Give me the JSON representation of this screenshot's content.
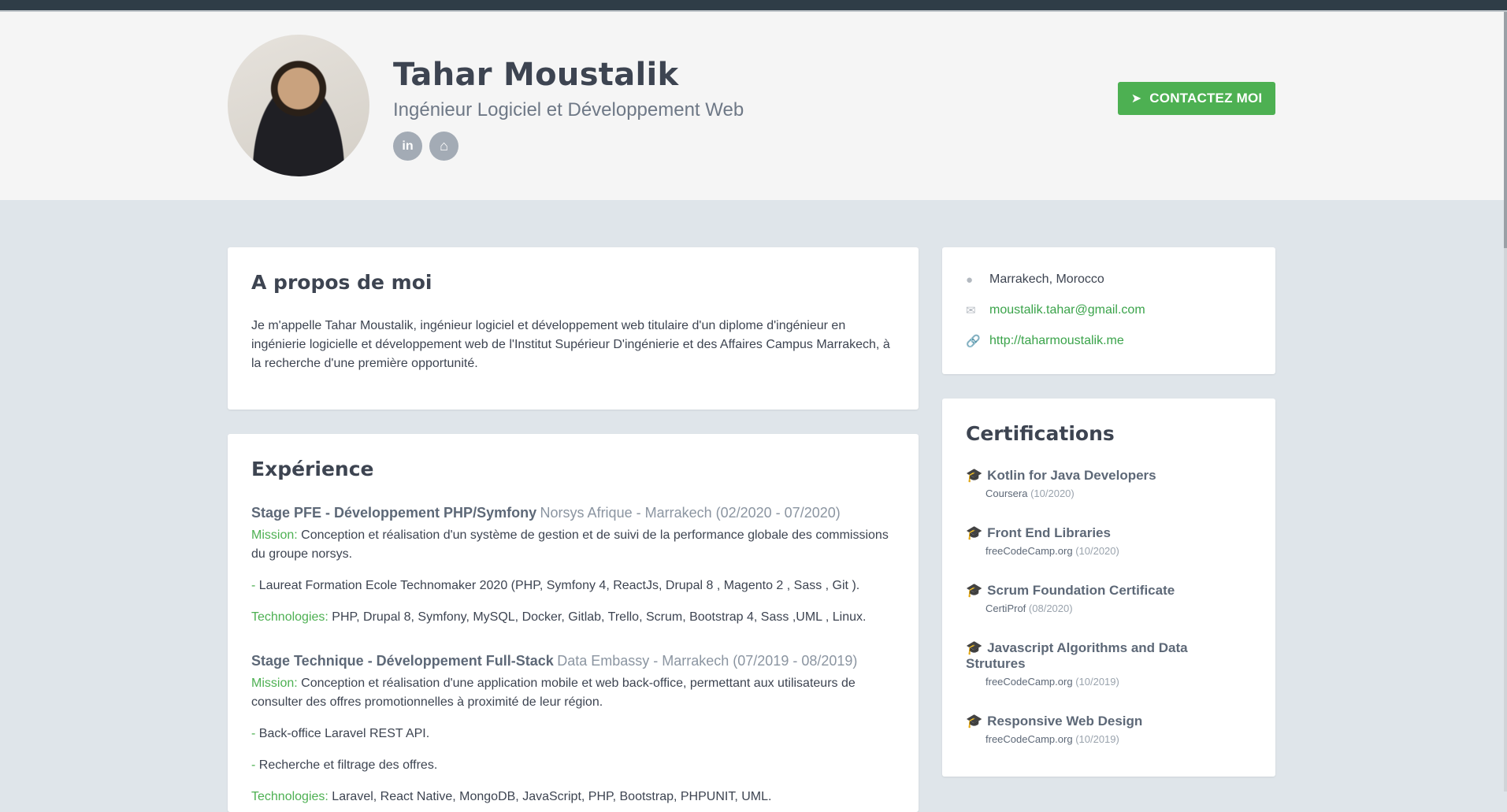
{
  "profile": {
    "name": "Tahar Moustalik",
    "tagline": "Ingénieur Logiciel et Développement Web",
    "social": [
      {
        "icon": "linkedin-icon",
        "label": "in"
      },
      {
        "icon": "github-icon",
        "label": "⌂"
      }
    ],
    "contact_button": "CONTACTEZ MOI"
  },
  "about": {
    "title": "A propos de moi",
    "text": "Je m'appelle Tahar Moustalik, ingénieur logiciel et développement web titulaire d'un diplome d'ingénieur en ingénierie logicielle et développement web de l'Institut Supérieur D'ingénierie et des Affaires Campus Marrakech, à la recherche d'une première opportunité."
  },
  "experience": {
    "title": "Expérience",
    "jobs": [
      {
        "title": "Stage PFE - Développement PHP/Symfony",
        "org": "Norsys Afrique - Marrakech (02/2020 - 07/2020)",
        "mission_label": "Mission:",
        "mission": "Conception et réalisation d'un système de gestion et de suivi de la performance globale des commissions du groupe norsys.",
        "bullets": [
          "Laureat Formation Ecole Technomaker 2020 (PHP, Symfony 4, ReactJs, Drupal 8 , Magento 2 , Sass , Git )."
        ],
        "tech_label": "Technologies:",
        "tech": "PHP, Drupal 8, Symfony, MySQL, Docker, Gitlab, Trello, Scrum, Bootstrap 4, Sass ,UML , Linux."
      },
      {
        "title": "Stage Technique - Développement Full-Stack",
        "org": "Data Embassy - Marrakech (07/2019 - 08/2019)",
        "mission_label": "Mission:",
        "mission": "Conception et réalisation d'une application mobile et web back-office, permettant aux utilisateurs de consulter des offres promotionnelles à proximité de leur région.",
        "bullets": [
          "Back-office Laravel REST API.",
          "Recherche et filtrage des offres."
        ],
        "tech_label": "Technologies:",
        "tech": "Laravel, React Native, MongoDB, JavaScript, PHP, Bootstrap, PHPUNIT, UML."
      }
    ]
  },
  "contact": {
    "location": "Marrakech, Morocco",
    "email": "moustalik.tahar@gmail.com",
    "website": "http://taharmoustalik.me"
  },
  "certifications": {
    "title": "Certifications",
    "items": [
      {
        "title": "Kotlin for Java Developers",
        "issuer": "Coursera",
        "date": "(10/2020)"
      },
      {
        "title": "Front End Libraries",
        "issuer": "freeCodeCamp.org",
        "date": "(10/2020)"
      },
      {
        "title": "Scrum Foundation Certificate",
        "issuer": "CertiProf",
        "date": "(08/2020)"
      },
      {
        "title": "Javascript Algorithms and Data Strutures",
        "issuer": "freeCodeCamp.org",
        "date": "(10/2019)"
      },
      {
        "title": "Responsive Web Design",
        "issuer": "freeCodeCamp.org",
        "date": "(10/2019)"
      }
    ]
  }
}
